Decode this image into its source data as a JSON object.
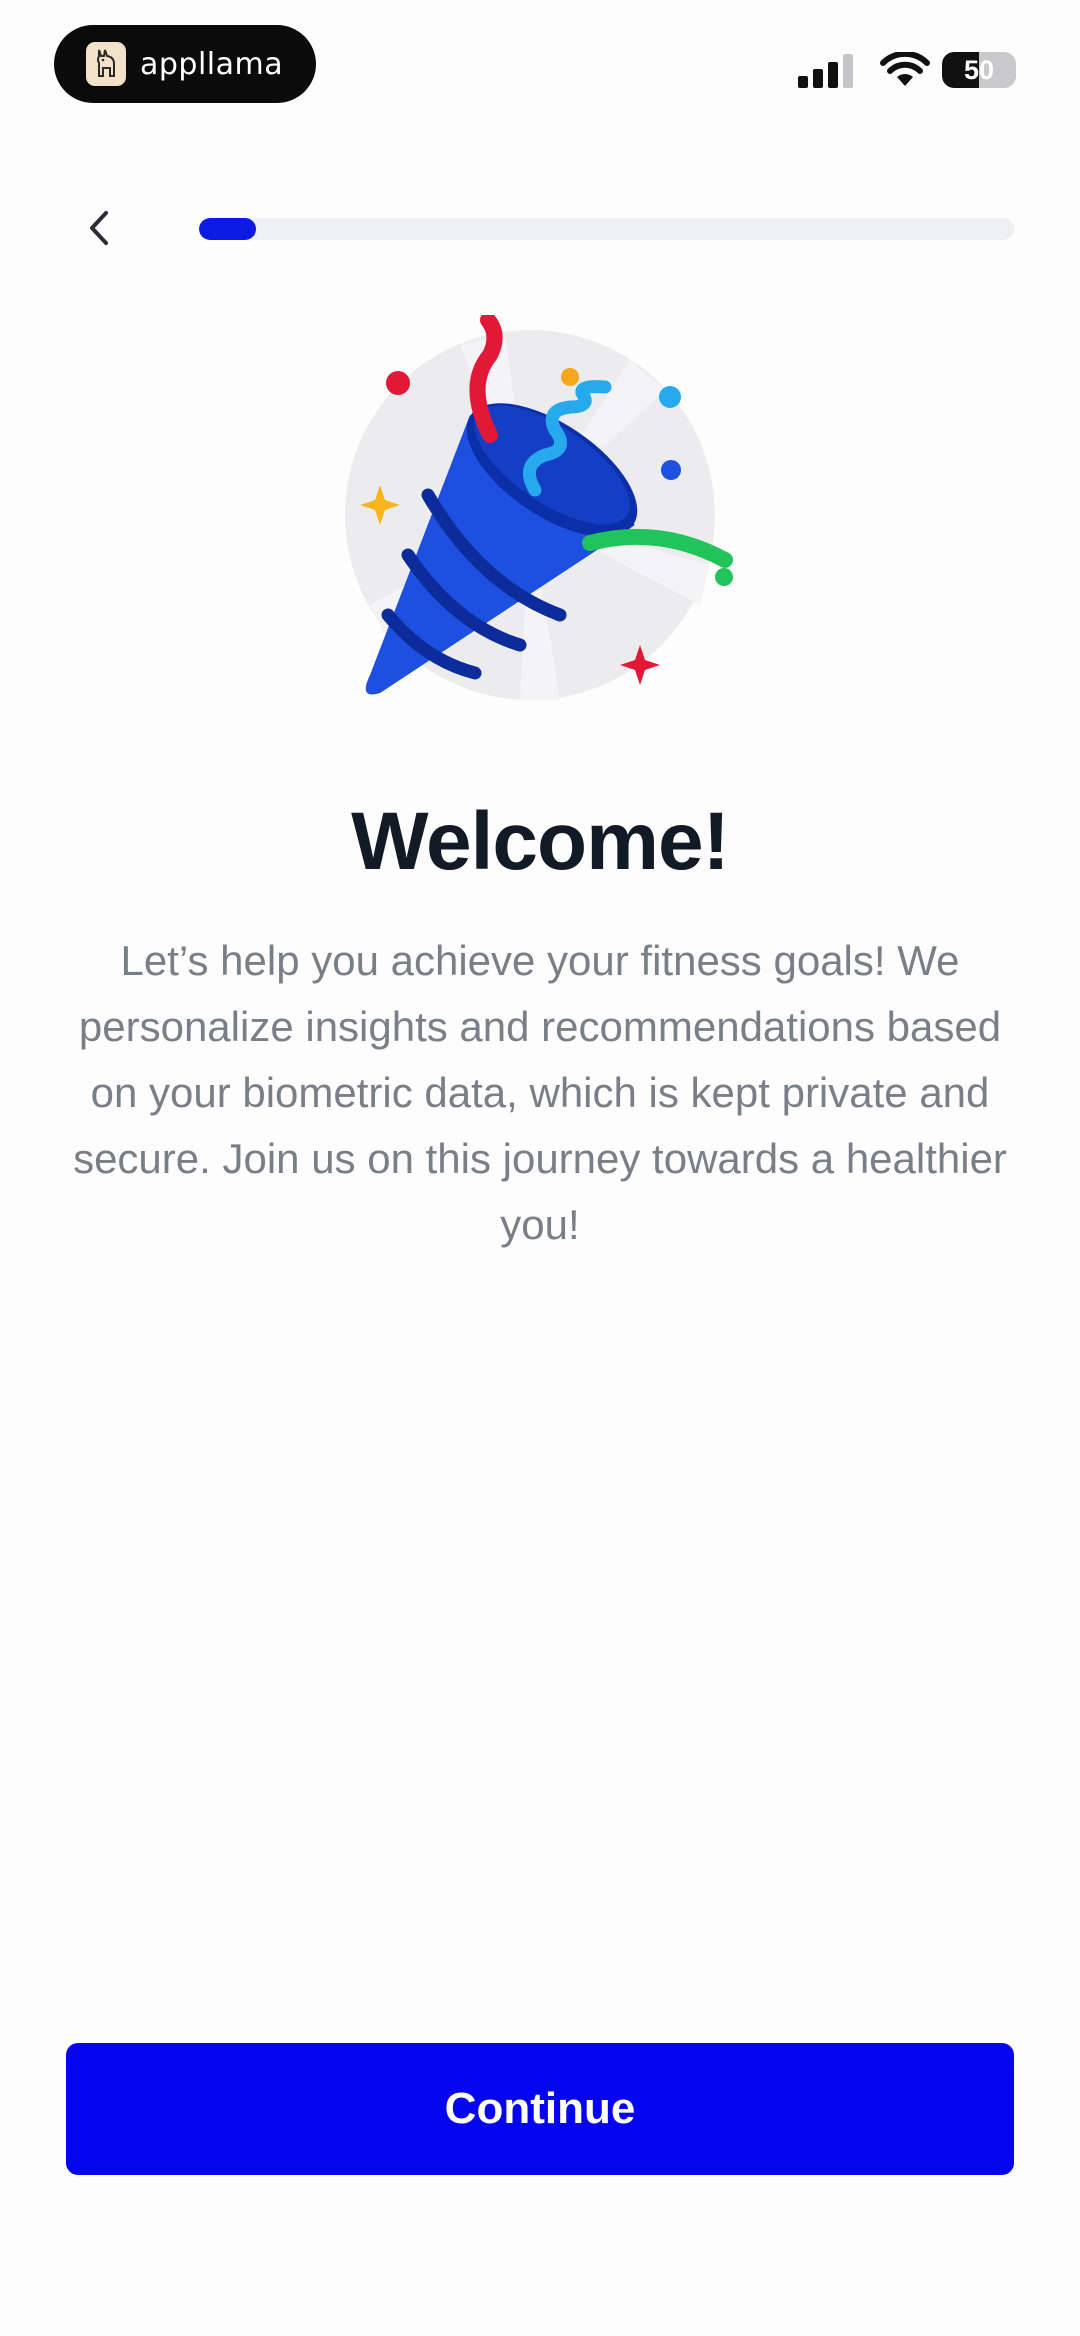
{
  "status_bar": {
    "app_name": "appllama",
    "battery": "50",
    "battery_level": 0.5
  },
  "nav": {
    "back_icon": "chevron-left-icon",
    "progress": 0.07
  },
  "hero": {
    "icon": "party-popper-icon"
  },
  "welcome": {
    "title": "Welcome!",
    "description": "Let’s help you achieve your fitness goals! We personalize insights and recommendations based on your biometric data, which is kept private and secure. Join us on this journey towards a healthier you!"
  },
  "footer": {
    "continue_label": "Continue"
  },
  "colors": {
    "accent": "#0505ef",
    "progress_fill": "#0b1be3",
    "title": "#121a26",
    "body_text": "#7a7f87"
  }
}
